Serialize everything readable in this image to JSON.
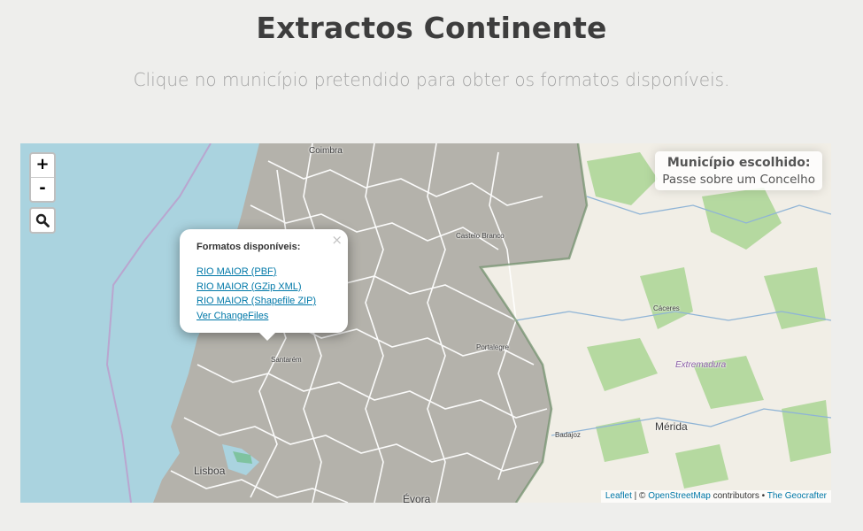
{
  "header": {
    "title": "Extractos Continente",
    "subtitle": "Clique no município pretendido para obter os formatos disponíveis."
  },
  "map": {
    "zoom_in": "+",
    "zoom_out": "-",
    "search_icon": "magnifier-icon",
    "info": {
      "title": "Município escolhido:",
      "hint": "Passe sobre um Concelho"
    },
    "popup": {
      "close": "×",
      "title": "Formatos disponíveis:",
      "links": [
        "RIO MAIOR (PBF)",
        "RIO MAIOR (GZip XML)",
        "RIO MAIOR (Shapefile ZIP)",
        "Ver ChangeFiles"
      ]
    },
    "places": {
      "coimbra": "Coimbra",
      "castelo_branco": "Castelo Branco",
      "caceres": "Cáceres",
      "extremadura": "Extremadura",
      "portalegre": "Portalegre",
      "santarem": "Santarém",
      "badajoz": "Badajoz",
      "merida": "Mérida",
      "lisboa": "Lisboa",
      "evora": "Évora"
    },
    "attribution": {
      "leaflet": "Leaflet",
      "separator": " | © ",
      "osm": "OpenStreetMap",
      "contributors": " contributors • ",
      "geocrafter": "The Geocrafter"
    },
    "colors": {
      "sea": "#aad3df",
      "municipalities": "#b2b0a9",
      "spain_land": "#f0ede4",
      "forest": "#a9d38e",
      "link": "#0078a8"
    }
  }
}
